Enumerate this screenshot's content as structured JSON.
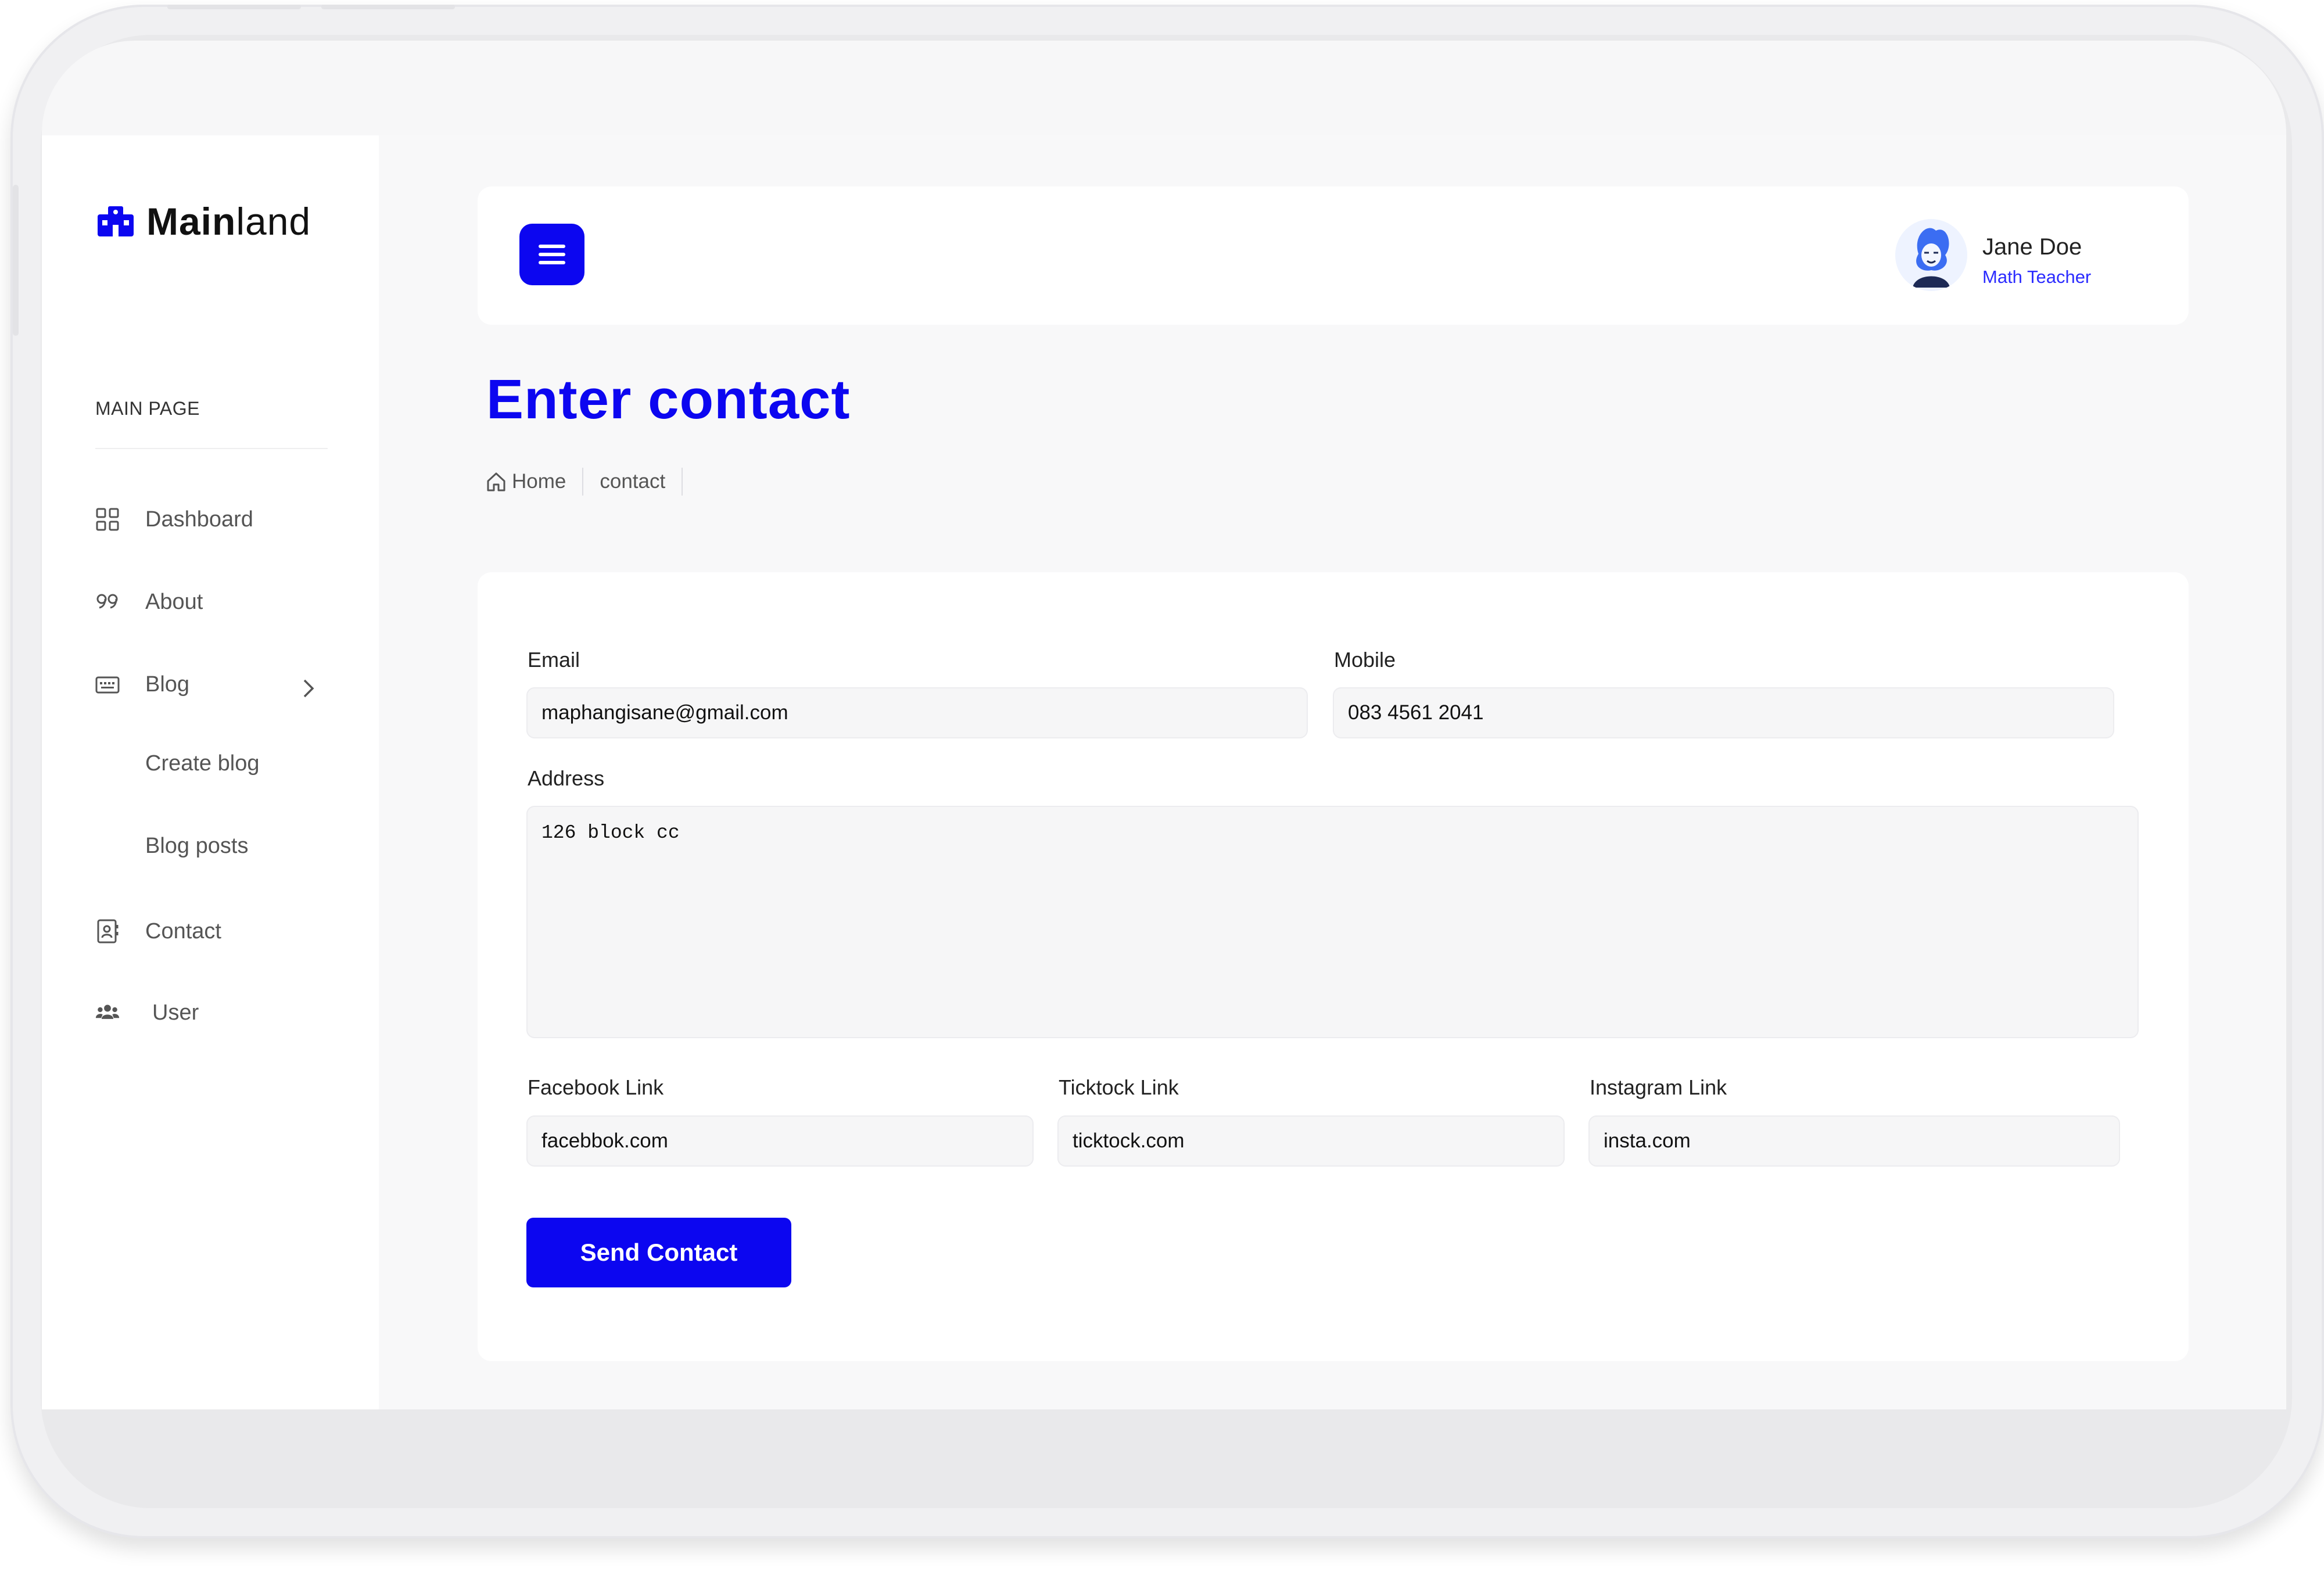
{
  "app": {
    "logo_bold": "Main",
    "logo_light": "land"
  },
  "sidebar": {
    "section_title": "MAIN PAGE",
    "items": [
      {
        "label": "Dashboard",
        "icon": "grid-icon"
      },
      {
        "label": "About",
        "icon": "quote-icon"
      },
      {
        "label": "Blog",
        "icon": "keyboard-icon"
      },
      {
        "label": "Create blog"
      },
      {
        "label": "Blog posts"
      },
      {
        "label": "Contact",
        "icon": "contact-book-icon"
      },
      {
        "label": "User",
        "icon": "users-icon"
      }
    ]
  },
  "header": {
    "menu_icon": "hamburger-icon",
    "user": {
      "name": "Jane Doe",
      "role": "Math Teacher"
    }
  },
  "page": {
    "title": "Enter contact",
    "breadcrumb": {
      "home": "Home",
      "current": "contact"
    }
  },
  "form": {
    "email": {
      "label": "Email",
      "value": "maphangisane@gmail.com"
    },
    "mobile": {
      "label": "Mobile",
      "value": "083 4561 2041"
    },
    "address": {
      "label": "Address",
      "value": "126 block cc"
    },
    "facebook": {
      "label": "Facebook Link",
      "value": "facebbok.com"
    },
    "ticktock": {
      "label": "Ticktock Link",
      "value": "ticktock.com"
    },
    "instagram": {
      "label": "Instagram Link",
      "value": "insta.com"
    },
    "submit_label": "Send Contact"
  },
  "colors": {
    "accent": "#0c06f0",
    "role_text": "#2b2bff",
    "background": "#f8f8f9"
  }
}
